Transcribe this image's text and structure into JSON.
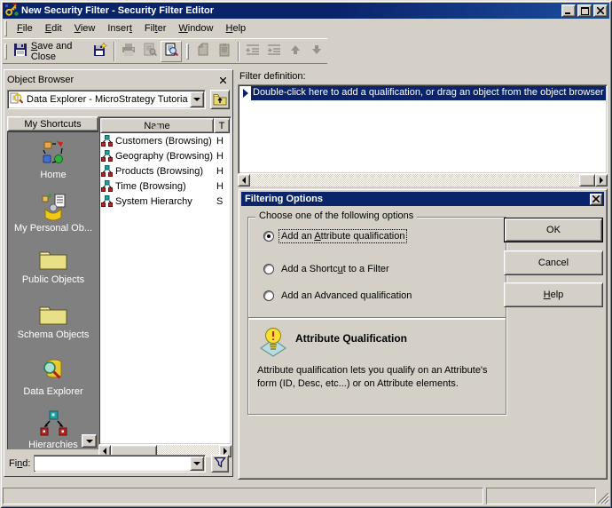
{
  "colors": {
    "titlebar": "#0a246a",
    "selection": "#0a246a",
    "window_bg": "#d4d0c8",
    "sidebar_bg": "#808080"
  },
  "window": {
    "title": "New Security Filter - Security Filter Editor"
  },
  "menu": {
    "items": [
      {
        "pre": "",
        "key": "F",
        "post": "ile"
      },
      {
        "pre": "",
        "key": "E",
        "post": "dit"
      },
      {
        "pre": "",
        "key": "V",
        "post": "iew"
      },
      {
        "pre": "Inser",
        "key": "t",
        "post": ""
      },
      {
        "pre": "Fil",
        "key": "t",
        "post": "er"
      },
      {
        "pre": "",
        "key": "W",
        "post": "indow"
      },
      {
        "pre": "",
        "key": "H",
        "post": "elp"
      }
    ]
  },
  "toolbar": {
    "save_and_close": {
      "pre": "",
      "key": "S",
      "post": "ave and Close"
    }
  },
  "object_browser": {
    "title": "Object Browser",
    "selector_value": "Data Explorer - MicroStrategy Tutoria",
    "shortcuts_header": "My Shortcuts",
    "shortcuts": [
      {
        "label": "Home"
      },
      {
        "label": "My Personal Ob..."
      },
      {
        "label": "Public Objects"
      },
      {
        "label": "Schema Objects"
      },
      {
        "label": "Data Explorer"
      },
      {
        "label": "Hierarchies"
      }
    ],
    "list": {
      "col_name": "Name",
      "col_type": "T",
      "rows": [
        {
          "name": "Customers (Browsing)",
          "type": "H"
        },
        {
          "name": "Geography (Browsing)",
          "type": "H"
        },
        {
          "name": "Products (Browsing)",
          "type": "H"
        },
        {
          "name": "Time (Browsing)",
          "type": "H"
        },
        {
          "name": "System Hierarchy",
          "type": "S"
        }
      ]
    },
    "find_label": {
      "pre": "Fi",
      "key": "n",
      "post": "d:"
    },
    "find_value": ""
  },
  "filter_definition": {
    "label": "Filter definition:",
    "prompt": "Double-click here to add a qualification, or drag an object from the object browser"
  },
  "dialog": {
    "title": "Filtering Options",
    "group_label": "Choose one of the following options",
    "options": [
      {
        "pre": "Add an ",
        "key": "A",
        "post": "ttribute qualification"
      },
      {
        "pre": "Add a Shortc",
        "key": "u",
        "post": "t to a Filter"
      },
      {
        "pre": "Add an Advanced qualification",
        "key": "",
        "post": ""
      }
    ],
    "buttons": {
      "ok": "OK",
      "cancel": "Cancel",
      "help": {
        "pre": "",
        "key": "H",
        "post": "elp"
      }
    },
    "info": {
      "title": "Attribute Qualification",
      "body": "Attribute qualification lets you qualify on an Attribute's form (ID, Desc, etc...) or on Attribute elements."
    }
  },
  "status_bar": {
    "left": "",
    "right": ""
  }
}
